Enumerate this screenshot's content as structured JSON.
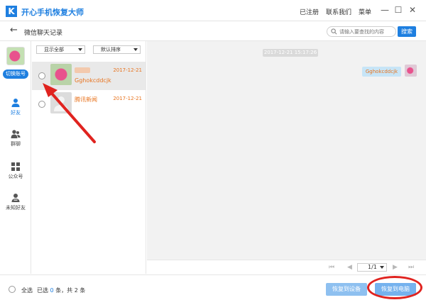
{
  "app": {
    "title": "开心手机恢复大师",
    "logo_letter": "K",
    "menu": [
      "已注册",
      "联系我们",
      "菜单"
    ],
    "win_controls": [
      "—",
      "☐",
      "✕"
    ]
  },
  "nav": {
    "title": "微信聊天记录",
    "search_placeholder": "请输入要查找的内容",
    "search_button": "搜索"
  },
  "sidebar": {
    "switch_account": "切换账号",
    "items": [
      {
        "label": "好友",
        "icon": "person-icon",
        "active": true
      },
      {
        "label": "群聊",
        "icon": "group-icon",
        "active": false
      },
      {
        "label": "公众号",
        "icon": "apps-icon",
        "active": false
      },
      {
        "label": "未知好友",
        "icon": "unknown-person-icon",
        "active": false
      }
    ]
  },
  "list": {
    "filter": "显示全部",
    "sort": "默认排序",
    "contacts": [
      {
        "name": "",
        "date": "2017-12-21",
        "message": "Gghokcddcjk",
        "selected": true
      },
      {
        "name": "腾讯新闻",
        "date": "2017-12-21",
        "message": "",
        "selected": false
      }
    ]
  },
  "chat": {
    "timestamp": "2017-12-21 15:17:26",
    "messages": [
      {
        "text": "Gghokcddcjk",
        "side": "right"
      }
    ]
  },
  "pager": {
    "page": "1/1"
  },
  "footer": {
    "select_all": "全选",
    "selected_prefix": "已选",
    "selected_count": "0",
    "selected_mid": "条，共",
    "total_count": "2",
    "total_suffix": "条",
    "restore_device": "恢复到设备",
    "restore_pc": "恢复到电脑"
  },
  "colors": {
    "accent": "#1e7fe0",
    "highlight": "#e8731e",
    "annotation": "#e0231f"
  }
}
